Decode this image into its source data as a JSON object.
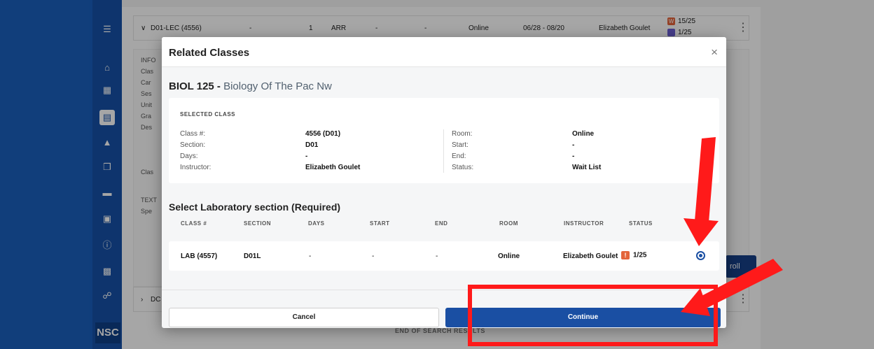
{
  "underlay": {
    "row": {
      "section": "D01-LEC (4556)",
      "dash1": "-",
      "units": "1",
      "arr": "ARR",
      "dash2": "-",
      "dash3": "-",
      "room": "Online",
      "dates": "06/28 - 08/20",
      "instructor": "Elizabeth Goulet",
      "waitlist_badge": "W",
      "waitlist_count": "15/25",
      "seats_count": "1/25"
    },
    "panel_labels": [
      "INFO",
      "Clas",
      "Car",
      "Ses",
      "Unit",
      "Gra",
      "Des",
      "Clas",
      "TEXT",
      "Spe"
    ],
    "second_row_label": "DC",
    "enroll_label": "roll",
    "end_results": "END OF SEARCH RESULTS"
  },
  "modal": {
    "title": "Related Classes",
    "close_icon": "×",
    "course_code": "BIOL 125 -",
    "course_name": "Biology Of The Pac Nw",
    "selected_class": {
      "heading": "SELECTED CLASS",
      "class_num_label": "Class #:",
      "class_num": "4556 (D01)",
      "section_label": "Section:",
      "section": "D01",
      "days_label": "Days:",
      "days": "-",
      "instructor_label": "Instructor:",
      "instructor": "Elizabeth Goulet",
      "room_label": "Room:",
      "room": "Online",
      "start_label": "Start:",
      "start": "-",
      "end_label": "End:",
      "end": "-",
      "status_label": "Status:",
      "status": "Wait List"
    },
    "lab_title": "Select Laboratory section (Required)",
    "table_headers": [
      "CLASS #",
      "SECTION",
      "DAYS",
      "START",
      "END",
      "ROOM",
      "INSTRUCTOR",
      "STATUS"
    ],
    "lab_row": {
      "class_num": "LAB (4557)",
      "section": "D01L",
      "days": "-",
      "start": "-",
      "end": "-",
      "room": "Online",
      "instructor": "Elizabeth Goulet",
      "status_badge": "!",
      "status": "1/25"
    },
    "cancel_label": "Cancel",
    "continue_label": "Continue"
  },
  "sidebar": {
    "logo": "NSC",
    "icons": [
      "menu-icon",
      "home-icon",
      "calendar-icon",
      "class-search-icon",
      "graduation-cap-icon",
      "documents-icon",
      "payment-card-icon",
      "id-card-icon",
      "info-icon",
      "profile-icon",
      "globe-icon"
    ]
  },
  "colors": {
    "brand_blue": "#1a4fa3",
    "sidebar_blue": "#1651a8",
    "warning_orange": "#e3653b",
    "annotation_red": "#ff1a1a"
  }
}
